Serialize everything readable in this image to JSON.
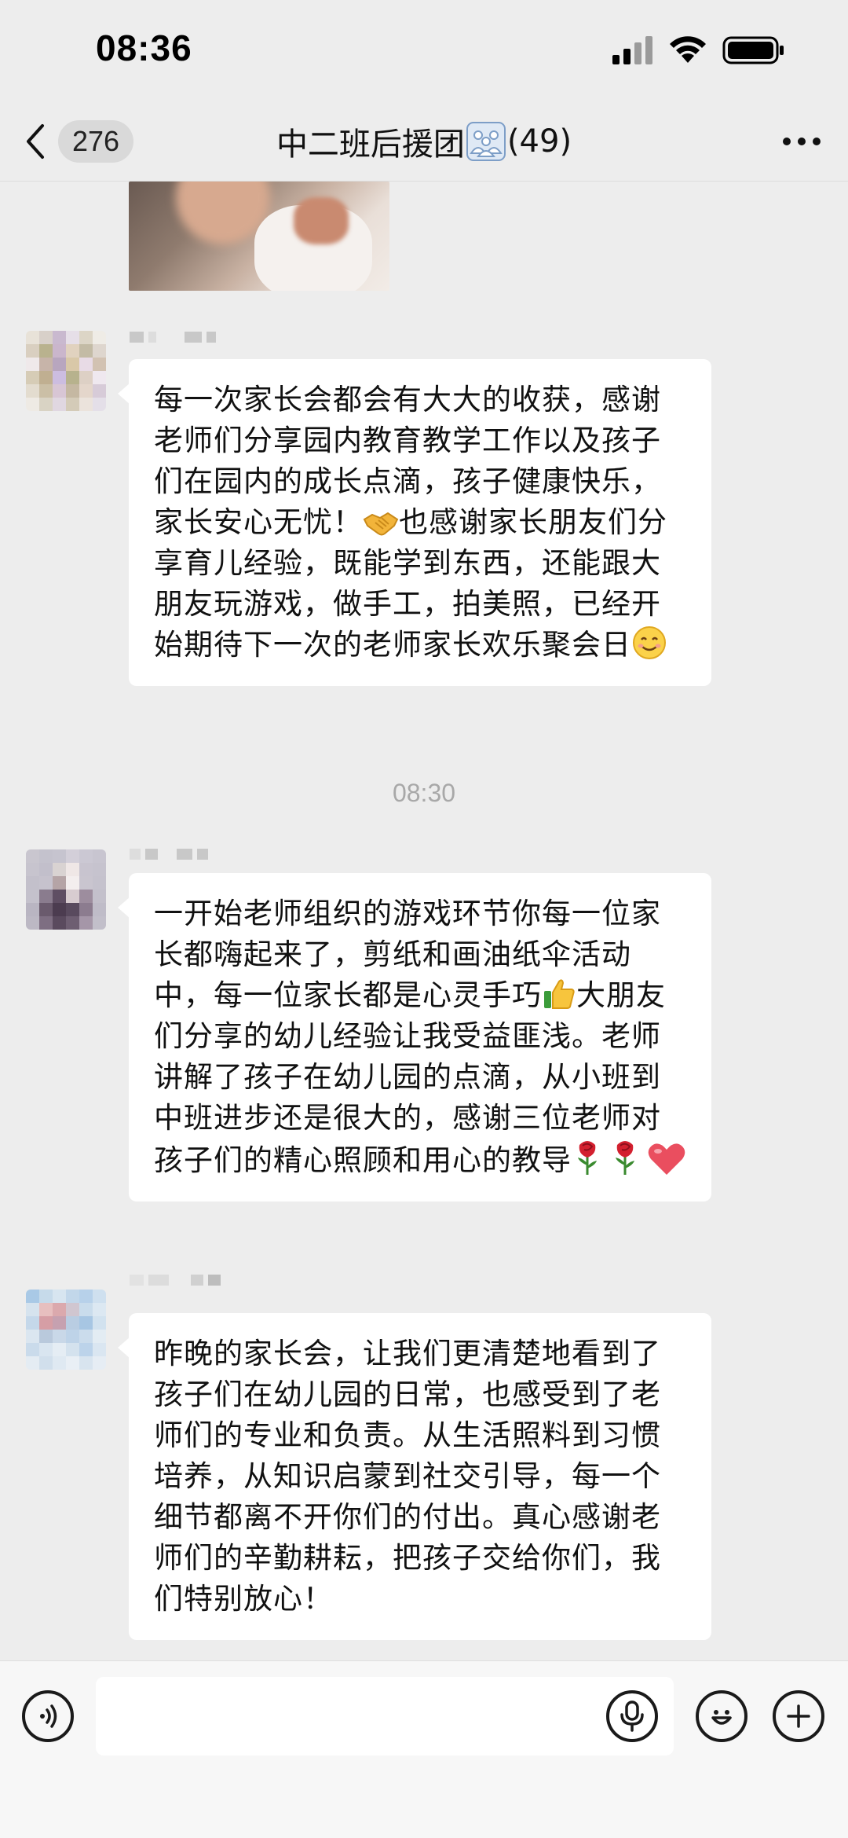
{
  "status_bar": {
    "time": "08:36"
  },
  "header": {
    "unread_count": "276",
    "title_prefix": "中二班后援团",
    "member_count": "(49)"
  },
  "messages": [
    {
      "type": "text",
      "text": "每一次家长会都会有大大的收获，感谢老师们分享园内教育教学工作以及孩子们在园内的成长点滴，孩子健康快乐，家长安心无忧！",
      "text_after_emoji_1": "也感谢家长朋友们分享育儿经验，既能学到东西，还能跟大朋友玩游戏，做手工，拍美照，已经开始期待下一次的老师家长欢乐聚会日",
      "emojis": [
        "handshake-icon",
        "smile-icon"
      ]
    },
    {
      "type": "time",
      "text": "08:30"
    },
    {
      "type": "text",
      "text": "一开始老师组织的游戏环节你每一位家长都嗨起来了，剪纸和画油纸伞活动中，每一位家长都是心灵手巧",
      "text_after_emoji_1": "大朋友们分享的幼儿经验让我受益匪浅。老师讲解了孩子在幼儿园的点滴，从小班到中班进步还是很大的，感谢三位老师对孩子们的精心照顾和用心的教导",
      "emojis": [
        "thumbs-up-icon",
        "rose-icon",
        "rose-icon",
        "heart-icon"
      ]
    },
    {
      "type": "text",
      "text": "昨晚的家长会，让我们更清楚地看到了孩子们在幼儿园的日常，也感受到了老师们的专业和负责。从生活照料到习惯培养，从知识启蒙到社交引导，每一个细节都离不开你们的付出。真心感谢老师们的辛勤耕耘，把孩子交给你们，我们特别放心！"
    }
  ],
  "input_bar": {
    "placeholder": "",
    "value": ""
  },
  "colors": {
    "background": "#ededed",
    "bubble": "#ffffff",
    "time_divider": "#a8a8a8",
    "input_bar": "#f7f7f7"
  }
}
